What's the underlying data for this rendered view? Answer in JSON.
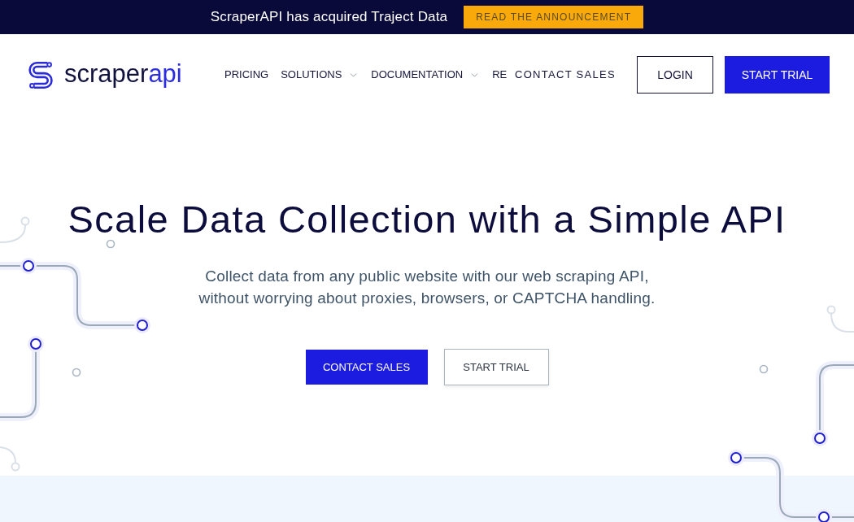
{
  "banner": {
    "text": "ScraperAPI has acquired Traject Data",
    "button": "READ THE ANNOUNCEMENT"
  },
  "header": {
    "logo": {
      "name": "scraper",
      "accent": "api"
    },
    "nav": [
      {
        "label": "PRICING",
        "kind": "link"
      },
      {
        "label": "SOLUTIONS",
        "kind": "dropdown"
      },
      {
        "label": "DOCUMENTATION",
        "kind": "dropdown"
      },
      {
        "label": "RE",
        "kind": "link"
      }
    ],
    "actions": [
      {
        "label": "CONTACT SALES",
        "kind": "text"
      },
      {
        "label": "LOGIN",
        "kind": "outline"
      },
      {
        "label": "START TRIAL",
        "kind": "solid"
      }
    ]
  },
  "hero": {
    "title": "Scale Data Collection with a Simple API",
    "subtitle": "Collect data from any public website with our web scraping API, without worrying about proxies, browsers, or CAPTCHA handling.",
    "buttons": [
      {
        "label": "CONTACT SALES",
        "kind": "solid"
      },
      {
        "label": "START TRIAL",
        "kind": "outline"
      }
    ]
  }
}
